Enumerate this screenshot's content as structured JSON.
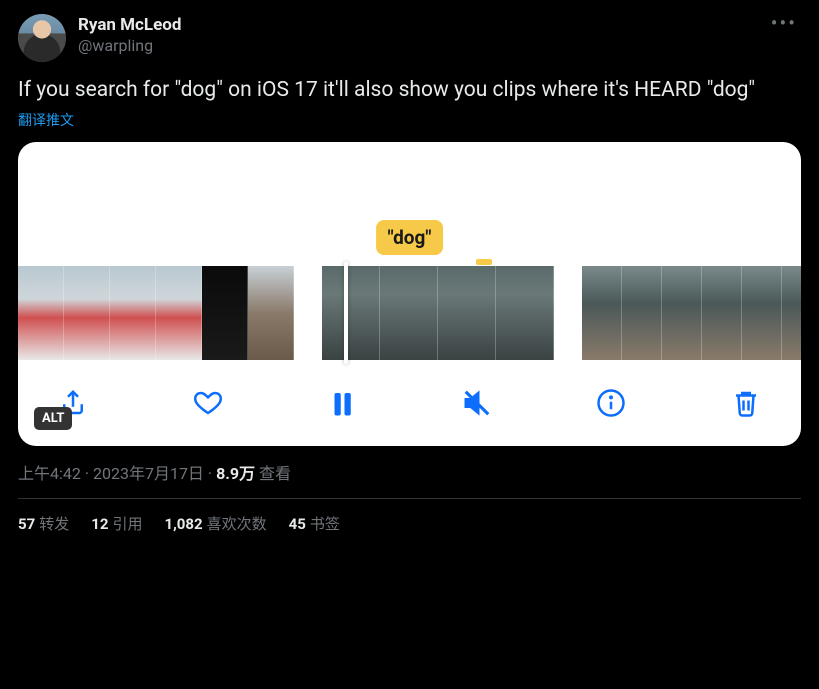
{
  "author": {
    "display_name": "Ryan McLeod",
    "handle": "@warpling"
  },
  "tweet_text": "If you search for \"dog\" on iOS 17 it'll also show you clips where it's HEARD \"dog\"",
  "translate_label": "翻译推文",
  "media": {
    "caption_bubble": "\"dog\"",
    "alt_badge": "ALT"
  },
  "meta": {
    "time": "上午4:42",
    "sep1": " · ",
    "date": "2023年7月17日",
    "sep2": " · ",
    "views_value": "8.9万",
    "views_label": " 查看"
  },
  "stats": {
    "retweets": {
      "count": "57",
      "label": "转发"
    },
    "quotes": {
      "count": "12",
      "label": "引用"
    },
    "likes": {
      "count": "1,082",
      "label": "喜欢次数"
    },
    "bookmarks": {
      "count": "45",
      "label": "书签"
    }
  }
}
